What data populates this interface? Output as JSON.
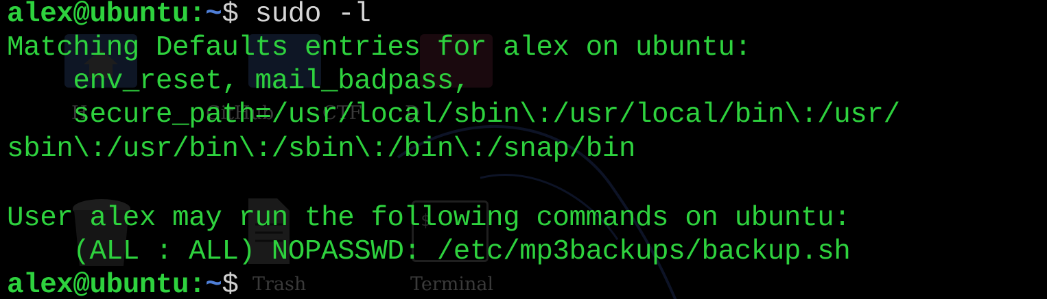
{
  "desktop": {
    "icons": [
      {
        "name": "home-folder-icon",
        "label": "H"
      },
      {
        "name": "folder-icon",
        "label": "GitHub"
      },
      {
        "name": "folder-icon-2",
        "label": "CTF"
      },
      {
        "name": "folder-icon-3",
        "label": "D"
      },
      {
        "name": "trash-icon",
        "label": "Trash"
      },
      {
        "name": "document-icon",
        "label": ""
      },
      {
        "name": "terminal-icon",
        "label": "Terminal"
      }
    ],
    "terminal_icon_glyph": "$"
  },
  "terminal": {
    "prompt_user": "alex@ubuntu",
    "prompt_sep": ":",
    "prompt_path": "~",
    "prompt_symbol": "$",
    "command": "sudo -l",
    "lines": [
      "Matching Defaults entries for alex on ubuntu:",
      "    env_reset, mail_badpass,",
      "    secure_path=/usr/local/sbin\\:/usr/local/bin\\:/usr/",
      "sbin\\:/usr/bin\\:/sbin\\:/bin\\:/snap/bin",
      "",
      "User alex may run the following commands on ubuntu:",
      "    (ALL : ALL) NOPASSWD: /etc/mp3backups/backup.sh"
    ],
    "colors": {
      "text": "#2ed23e",
      "path": "#4f7fd8",
      "command": "#d6d6d6",
      "background": "#000000"
    }
  }
}
